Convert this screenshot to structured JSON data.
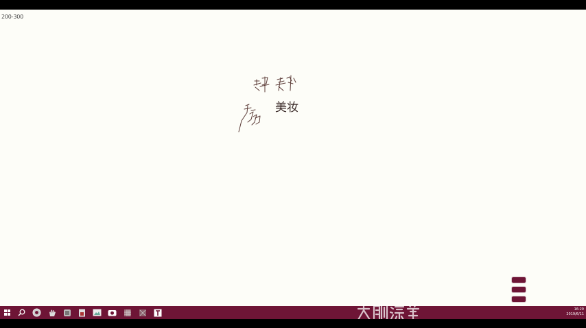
{
  "canvas": {
    "corner_text": "200-300",
    "center_label": "美妆"
  },
  "side_buttons": [
    "",
    "",
    ""
  ],
  "taskbar": {
    "icons": [
      "windows-start-icon",
      "search-icon",
      "browser-icon",
      "hand-icon",
      "app-icon",
      "document-icon",
      "picture-icon",
      "camera-icon",
      "grid-icon",
      "text-icon"
    ],
    "clock_time": "16:29",
    "clock_date": "2019/6/11"
  },
  "colors": {
    "taskbar": "#6e1536",
    "canvas": "#fdfdf8",
    "ink": "#5a3a36"
  }
}
